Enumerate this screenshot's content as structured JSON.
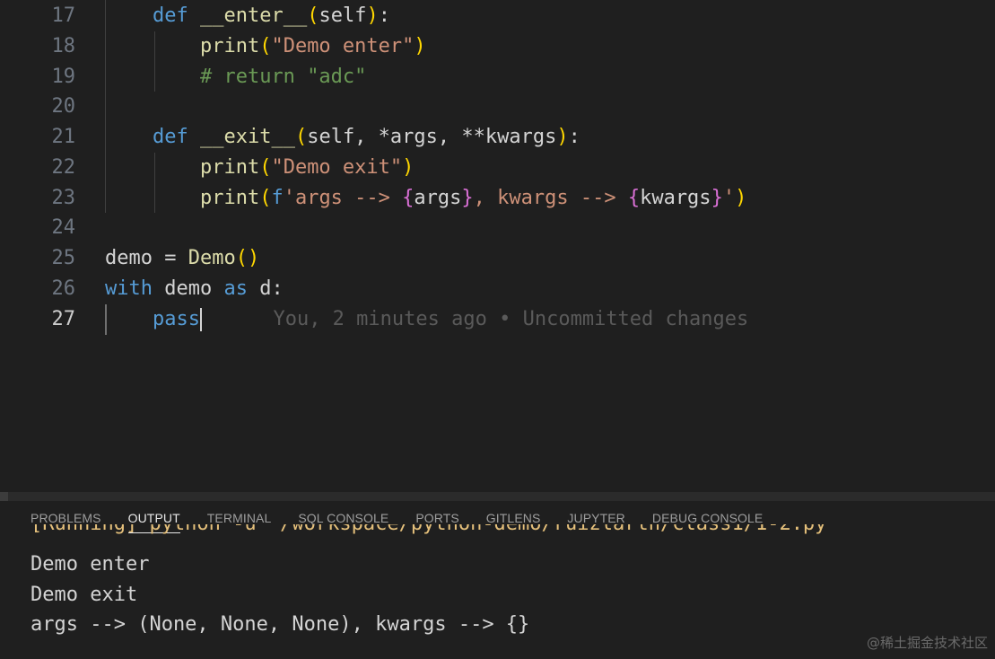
{
  "editor": {
    "lines": [
      {
        "num": "17",
        "tokens": [
          {
            "t": "    "
          },
          {
            "t": "def",
            "c": "kw"
          },
          {
            "t": " "
          },
          {
            "t": "__enter__",
            "c": "fn"
          },
          {
            "t": "(",
            "c": "p1"
          },
          {
            "t": "self",
            "c": "plain"
          },
          {
            "t": ")",
            "c": "p1"
          },
          {
            "t": ":"
          }
        ]
      },
      {
        "num": "18",
        "tokens": [
          {
            "t": "        "
          },
          {
            "t": "print",
            "c": "fn"
          },
          {
            "t": "(",
            "c": "p1"
          },
          {
            "t": "\"Demo enter\"",
            "c": "str"
          },
          {
            "t": ")",
            "c": "p1"
          }
        ]
      },
      {
        "num": "19",
        "tokens": [
          {
            "t": "        "
          },
          {
            "t": "# return ",
            "c": "cmt"
          },
          {
            "t": "\"adc\"",
            "c": "cmt"
          }
        ]
      },
      {
        "num": "20",
        "tokens": []
      },
      {
        "num": "21",
        "tokens": [
          {
            "t": "    "
          },
          {
            "t": "def",
            "c": "kw"
          },
          {
            "t": " "
          },
          {
            "t": "__exit__",
            "c": "fn"
          },
          {
            "t": "(",
            "c": "p1"
          },
          {
            "t": "self, *args, **kwargs"
          },
          {
            "t": ")",
            "c": "p1"
          },
          {
            "t": ":"
          }
        ]
      },
      {
        "num": "22",
        "tokens": [
          {
            "t": "        "
          },
          {
            "t": "print",
            "c": "fn"
          },
          {
            "t": "(",
            "c": "p1"
          },
          {
            "t": "\"Demo exit\"",
            "c": "str"
          },
          {
            "t": ")",
            "c": "p1"
          }
        ]
      },
      {
        "num": "23",
        "tokens": [
          {
            "t": "        "
          },
          {
            "t": "print",
            "c": "fn"
          },
          {
            "t": "(",
            "c": "p1"
          },
          {
            "t": "f",
            "c": "kw"
          },
          {
            "t": "'args --> ",
            "c": "str"
          },
          {
            "t": "{",
            "c": "p2"
          },
          {
            "t": "args"
          },
          {
            "t": "}",
            "c": "p2"
          },
          {
            "t": ", kwargs --> ",
            "c": "str"
          },
          {
            "t": "{",
            "c": "p2"
          },
          {
            "t": "kwargs"
          },
          {
            "t": "}",
            "c": "p2"
          },
          {
            "t": "'",
            "c": "str"
          },
          {
            "t": ")",
            "c": "p1"
          }
        ]
      },
      {
        "num": "24",
        "tokens": []
      },
      {
        "num": "25",
        "tokens": [
          {
            "t": "demo = "
          },
          {
            "t": "Demo",
            "c": "fn"
          },
          {
            "t": "()",
            "c": "p1"
          }
        ]
      },
      {
        "num": "26",
        "tokens": [
          {
            "t": "with",
            "c": "kw"
          },
          {
            "t": " demo "
          },
          {
            "t": "as",
            "c": "kw"
          },
          {
            "t": " d:"
          }
        ]
      },
      {
        "num": "27",
        "tokens": [
          {
            "t": "    "
          },
          {
            "t": "pass",
            "c": "kw"
          }
        ],
        "active": true,
        "cursor": true,
        "blame": "You, 2 minutes ago • Uncommitted changes"
      }
    ]
  },
  "panel": {
    "tabs": [
      {
        "label": "PROBLEMS",
        "active": false
      },
      {
        "label": "OUTPUT",
        "active": true
      },
      {
        "label": "TERMINAL",
        "active": false
      },
      {
        "label": "SQL CONSOLE",
        "active": false
      },
      {
        "label": "PORTS",
        "active": false
      },
      {
        "label": "GITLENS",
        "active": false
      },
      {
        "label": "JUPYTER",
        "active": false
      },
      {
        "label": "DEBUG CONSOLE",
        "active": false
      }
    ],
    "running_line": "[Running] python -u \"/workspace/python-demo/ruizlarth/class1/1-2.py\"",
    "output": [
      "Demo enter",
      "Demo exit",
      "args --> (None, None, None), kwargs --> {}"
    ]
  },
  "watermark": "@稀土掘金技术社区",
  "colors": {
    "keyword": "#569cd6",
    "function": "#dcdcaa",
    "string": "#ce9178",
    "comment": "#6a9955",
    "bracket_level1": "#ffd700",
    "bracket_level2": "#da70d6",
    "background": "#1f1f1f"
  }
}
